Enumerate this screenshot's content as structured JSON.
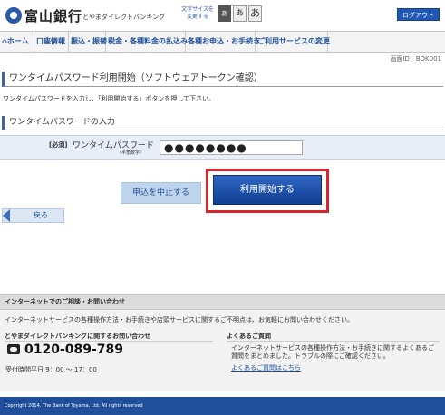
{
  "header": {
    "bank_name": "富山銀行",
    "sub_name": "とやまダイレクトバンキング",
    "font_size_label": "文字サイズを変更する",
    "font_sizes": [
      "あ",
      "あ",
      "あ"
    ],
    "logout_label": "ログアウト"
  },
  "nav": {
    "items": [
      {
        "label": "ホーム"
      },
      {
        "label": "口座情報"
      },
      {
        "label": "振込・振替"
      },
      {
        "label": "税金・各種料金の払込み"
      },
      {
        "label": "各種お申込・お手続き"
      },
      {
        "label": "ご利用サービスの変更"
      }
    ]
  },
  "screen_id": "画面ID：BOK001",
  "page_title": "ワンタイムパスワード利用開始（ソフトウェアトークン確認）",
  "intro_text": "ワンタイムパスワードを入力し、「利用開始する」ボタンを押して下さい。",
  "section_title": "ワンタイムパスワードの入力",
  "form": {
    "required_label": "[必須]",
    "field_label": "ワンタイムパスワード",
    "field_sublabel": "（半角数字）",
    "password_value": "●●●●●●●●"
  },
  "buttons": {
    "cancel_label": "申込を中止する",
    "start_label": "利用開始する",
    "back_label": "戻る"
  },
  "footer": {
    "bar_title": "インターネットでのご相談・お問い合わせ",
    "info_text": "インターネットサービスの各種操作方法・お手続きや店頭サービスに関するご不明点は、お気軽にお問い合わせください。",
    "left_title": "とやまダイレクトバンキングに関するお問い合わせ",
    "phone": "0120-089-789",
    "hours": "受付時間平日 9：00 ～ 17：00",
    "right_title": "よくあるご質問",
    "faq_text": "インターネットサービスの各種操作方法・お手続きに関するよくあるご質問をまとめました。トラブルの際にご確認ください。",
    "faq_link": "よくあるご質問はこちら",
    "copyright": "Copyright 2014. The Bank of Toyama, Ltd. All rights reserved"
  },
  "colors": {
    "brand_blue": "#1f4f9a",
    "highlight_red": "#d8262e",
    "primary_button": "#1a4ea8"
  }
}
